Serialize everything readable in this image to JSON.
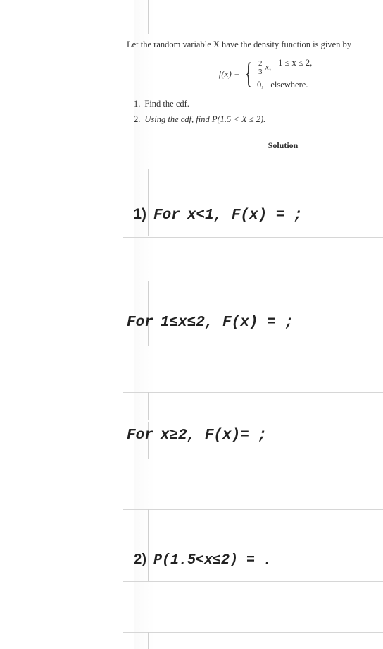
{
  "problem": {
    "intro": "Let the random variable X have the density function is given by",
    "f_label": "f(x) =",
    "case1_frac_num": "2",
    "case1_frac_den": "3",
    "case1_after": "x,",
    "case1_cond": "1 ≤ x ≤ 2,",
    "case2_val": "0,",
    "case2_cond": "elsewhere.",
    "q1_num": "1.",
    "q1": "Find the cdf.",
    "q2_num": "2.",
    "q2": "Using the cdf, find P(1.5 < X ≤ 2).",
    "solution": "Solution"
  },
  "answers": {
    "a1_num": "1)",
    "a1_line1_for": "For",
    "a1_line1_expr": "x<1,   F(x) = ;",
    "a1_line2_for": "For",
    "a1_line2_expr": "1≤x≤2,  F(x) = ;",
    "a1_line3_for": "For",
    "a1_line3_expr": " x≥2,  F(x)= ;",
    "a2_num": "2)",
    "a2_expr": "P(1.5<x≤2)  = ."
  }
}
